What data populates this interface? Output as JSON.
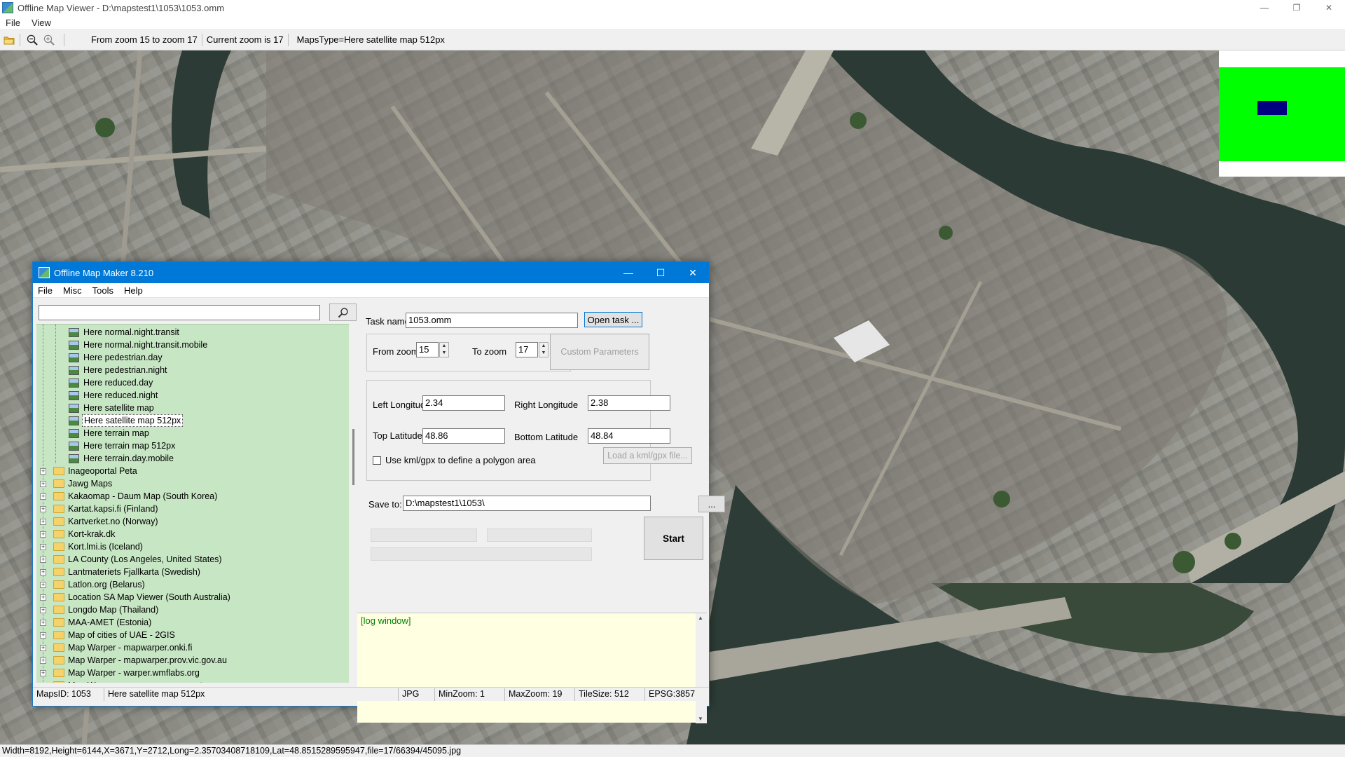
{
  "window": {
    "title": "Offline Map Viewer - D:\\mapstest1\\1053\\1053.omm",
    "icon": "map-app-icon",
    "controls": {
      "minimize": "—",
      "restore": "❐",
      "close": "✕"
    }
  },
  "menubar": {
    "items": [
      {
        "label": "File"
      },
      {
        "label": "View"
      }
    ]
  },
  "toolbar": {
    "icons": [
      "open-folder-icon",
      "zoom-out-icon",
      "zoom-in-icon"
    ],
    "zoom_range": "From zoom 15 to zoom 17",
    "current_zoom": "Current zoom is 17",
    "maps_type": "MapsType=Here satellite map 512px"
  },
  "minimap": {
    "background_color": "#00ff00",
    "viewport_color": "#000080"
  },
  "statusbar": {
    "text": "Width=8192,Height=6144,X=3671,Y=2712,Long=2.35703408718109,Lat=48.8515289595947,file=17/66394/45095.jpg"
  },
  "dialog": {
    "title": "Offline Map Maker 8.210",
    "controls": {
      "minimize": "—",
      "maximize": "☐",
      "close": "✕"
    },
    "menu": [
      {
        "label": "File"
      },
      {
        "label": "Misc"
      },
      {
        "label": "Tools"
      },
      {
        "label": "Help"
      }
    ],
    "search": {
      "value": "",
      "icon": "search-icon"
    },
    "tree": {
      "child_items": [
        {
          "label": "Here normal.night.transit",
          "selected": false
        },
        {
          "label": "Here normal.night.transit.mobile",
          "selected": false
        },
        {
          "label": "Here pedestrian.day",
          "selected": false
        },
        {
          "label": "Here pedestrian.night",
          "selected": false
        },
        {
          "label": "Here reduced.day",
          "selected": false
        },
        {
          "label": "Here reduced.night",
          "selected": false
        },
        {
          "label": "Here satellite map",
          "selected": false
        },
        {
          "label": "Here satellite map 512px",
          "selected": true
        },
        {
          "label": "Here terrain map",
          "selected": false
        },
        {
          "label": "Here terrain map 512px",
          "selected": false
        },
        {
          "label": "Here terrain.day.mobile",
          "selected": false
        }
      ],
      "folders": [
        {
          "label": "Inageoportal Peta"
        },
        {
          "label": "Jawg Maps"
        },
        {
          "label": "Kakaomap - Daum Map (South Korea)"
        },
        {
          "label": "Kartat.kapsi.fi (Finland)"
        },
        {
          "label": "Kartverket.no (Norway)"
        },
        {
          "label": "Kort-krak.dk"
        },
        {
          "label": "Kort.lmi.is (Iceland)"
        },
        {
          "label": "LA County (Los Angeles, United States)"
        },
        {
          "label": "Lantmateriets Fjallkarta (Swedish)"
        },
        {
          "label": "Latlon.org (Belarus)"
        },
        {
          "label": "Location SA Map Viewer (South Australia)"
        },
        {
          "label": "Longdo Map (Thailand)"
        },
        {
          "label": "MAA-AMET (Estonia)"
        },
        {
          "label": "Map of cities of UAE - 2GIS"
        },
        {
          "label": "Map Warper - mapwarper.onki.fi"
        },
        {
          "label": "Map Warper - mapwarper.prov.vic.gov.au"
        },
        {
          "label": "Map Warper - warper.wmflabs.org"
        },
        {
          "label": "Map Warper - www.mapwarper.net"
        }
      ]
    },
    "form": {
      "task_name_label": "Task name",
      "task_name_value": "1053.omm",
      "open_task_label": "Open task ...",
      "from_zoom_label": "From zoom",
      "from_zoom_value": "15",
      "to_zoom_label": "To zoom",
      "to_zoom_value": "17",
      "custom_params_label": "Custom Parameters",
      "left_lon_label": "Left Longitude",
      "left_lon_value": "2.34",
      "right_lon_label": "Right Longitude",
      "right_lon_value": "2.38",
      "top_lat_label": "Top Latitude",
      "top_lat_value": "48.86",
      "bottom_lat_label": "Bottom Latitude",
      "bottom_lat_value": "48.84",
      "kml_checkbox_label": "Use kml/gpx to define a polygon area",
      "kml_checked": false,
      "load_kml_label": "Load a kml/gpx file...",
      "save_to_label": "Save to:",
      "save_to_value": "D:\\mapstest1\\1053\\",
      "browse_label": "...",
      "start_label": "Start"
    },
    "log": {
      "text": "[log window]",
      "text_color": "#008000"
    },
    "status": {
      "maps_id": "MapsID: 1053",
      "map_name": "Here satellite map 512px",
      "format": "JPG",
      "min_zoom": "MinZoom: 1",
      "max_zoom": "MaxZoom: 19",
      "tile_size": "TileSize: 512",
      "epsg": "EPSG:3857"
    }
  }
}
